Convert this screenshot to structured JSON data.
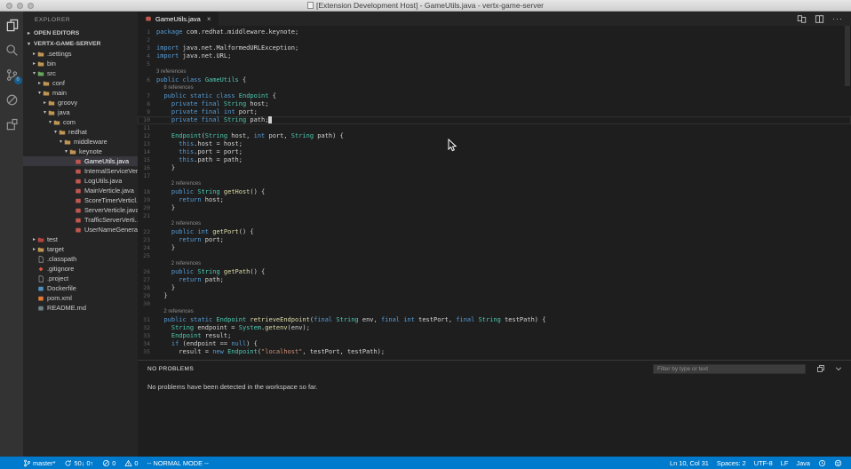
{
  "window": {
    "title": "[Extension Development Host] - GameUtils.java - vertx-game-server"
  },
  "colors": {
    "accent": "#007acc",
    "editor_bg": "#1e1e1e",
    "sidebar_bg": "#252526",
    "activity_bg": "#333333"
  },
  "activity_bar": {
    "items": [
      {
        "name": "explorer",
        "active": true
      },
      {
        "name": "search",
        "active": false
      },
      {
        "name": "source-control",
        "active": false,
        "badge": "6"
      },
      {
        "name": "debug",
        "active": false
      },
      {
        "name": "extensions",
        "active": false
      }
    ]
  },
  "sidebar": {
    "title": "EXPLORER",
    "sections": [
      {
        "label": "OPEN EDITORS",
        "state": "collapsed"
      },
      {
        "label": "VERTX-GAME-SERVER",
        "state": "expanded"
      }
    ],
    "tree": [
      {
        "label": ".settings",
        "level": 1,
        "icon": "folder",
        "arrow": "collapsed"
      },
      {
        "label": "bin",
        "level": 1,
        "icon": "folder",
        "arrow": "collapsed"
      },
      {
        "label": "src",
        "level": 1,
        "icon": "folder-src",
        "arrow": "expanded"
      },
      {
        "label": "conf",
        "level": 2,
        "icon": "folder",
        "arrow": "collapsed"
      },
      {
        "label": "main",
        "level": 2,
        "icon": "folder",
        "arrow": "expanded"
      },
      {
        "label": "groovy",
        "level": 3,
        "icon": "folder",
        "arrow": "collapsed"
      },
      {
        "label": "java",
        "level": 3,
        "icon": "folder",
        "arrow": "expanded"
      },
      {
        "label": "com",
        "level": 4,
        "icon": "folder",
        "arrow": "expanded"
      },
      {
        "label": "redhat",
        "level": 5,
        "icon": "folder",
        "arrow": "expanded"
      },
      {
        "label": "middleware",
        "level": 6,
        "icon": "folder",
        "arrow": "expanded"
      },
      {
        "label": "keynote",
        "level": 7,
        "icon": "folder",
        "arrow": "expanded"
      },
      {
        "label": "GameUtils.java",
        "level": 8,
        "icon": "java",
        "selected": true
      },
      {
        "label": "InternalServiceVer...",
        "level": 8,
        "icon": "java"
      },
      {
        "label": "LogUtils.java",
        "level": 8,
        "icon": "java"
      },
      {
        "label": "MainVerticle.java",
        "level": 8,
        "icon": "java"
      },
      {
        "label": "ScoreTimerVerticl...",
        "level": 8,
        "icon": "java"
      },
      {
        "label": "ServerVerticle.java",
        "level": 8,
        "icon": "java"
      },
      {
        "label": "TrafficServerVerti...",
        "level": 8,
        "icon": "java"
      },
      {
        "label": "UserNameGenerat...",
        "level": 8,
        "icon": "java"
      },
      {
        "label": "test",
        "level": 1,
        "icon": "folder-test",
        "arrow": "collapsed"
      },
      {
        "label": "target",
        "level": 1,
        "icon": "folder",
        "arrow": "collapsed"
      },
      {
        "label": ".classpath",
        "level": 1,
        "icon": "file"
      },
      {
        "label": ".gitignore",
        "level": 1,
        "icon": "git"
      },
      {
        "label": ".project",
        "level": 1,
        "icon": "file"
      },
      {
        "label": "Dockerfile",
        "level": 1,
        "icon": "docker"
      },
      {
        "label": "pom.xml",
        "level": 1,
        "icon": "xml"
      },
      {
        "label": "README.md",
        "level": 1,
        "icon": "md"
      }
    ]
  },
  "editor": {
    "tabs": [
      {
        "label": "GameUtils.java",
        "icon": "java",
        "close": "×",
        "active": true
      }
    ],
    "actions": [
      {
        "name": "open-changes"
      },
      {
        "name": "split-editor"
      },
      {
        "name": "more-actions",
        "glyph": "···"
      }
    ],
    "code": {
      "lines": [
        {
          "n": "1",
          "t": [
            [
              "k",
              "package"
            ],
            [
              "p",
              " com.redhat.middleware.keynote;"
            ]
          ]
        },
        {
          "n": "2",
          "t": []
        },
        {
          "n": "3",
          "t": [
            [
              "k",
              "import"
            ],
            [
              "p",
              " java.net.MalformedURLException;"
            ]
          ]
        },
        {
          "n": "4",
          "t": [
            [
              "k",
              "import"
            ],
            [
              "p",
              " java.net.URL;"
            ]
          ]
        },
        {
          "n": "5",
          "t": []
        },
        {
          "cl": "3 references",
          "ind": 0
        },
        {
          "n": "6",
          "t": [
            [
              "k",
              "public"
            ],
            [
              "p",
              " "
            ],
            [
              "k",
              "class"
            ],
            [
              "p",
              " "
            ],
            [
              "t",
              "GameUtils"
            ],
            [
              "p",
              " {"
            ]
          ]
        },
        {
          "cl": "8 references",
          "ind": 2
        },
        {
          "n": "7",
          "t": [
            [
              "p",
              "  "
            ],
            [
              "k",
              "public"
            ],
            [
              "p",
              " "
            ],
            [
              "k",
              "static"
            ],
            [
              "p",
              " "
            ],
            [
              "k",
              "class"
            ],
            [
              "p",
              " "
            ],
            [
              "t",
              "Endpoint"
            ],
            [
              "p",
              " {"
            ]
          ]
        },
        {
          "n": "8",
          "t": [
            [
              "p",
              "    "
            ],
            [
              "k",
              "private"
            ],
            [
              "p",
              " "
            ],
            [
              "k",
              "final"
            ],
            [
              "p",
              " "
            ],
            [
              "t",
              "String"
            ],
            [
              "p",
              " host;"
            ]
          ]
        },
        {
          "n": "9",
          "t": [
            [
              "p",
              "    "
            ],
            [
              "k",
              "private"
            ],
            [
              "p",
              " "
            ],
            [
              "k",
              "final"
            ],
            [
              "p",
              " "
            ],
            [
              "k",
              "int"
            ],
            [
              "p",
              " port;"
            ]
          ]
        },
        {
          "n": "10",
          "t": [
            [
              "p",
              "    "
            ],
            [
              "k",
              "private"
            ],
            [
              "p",
              " "
            ],
            [
              "k",
              "final"
            ],
            [
              "p",
              " "
            ],
            [
              "t",
              "String"
            ],
            [
              "p",
              " path;"
            ]
          ],
          "cur": true
        },
        {
          "n": "11",
          "t": []
        },
        {
          "n": "12",
          "t": [
            [
              "p",
              "    "
            ],
            [
              "t",
              "Endpoint"
            ],
            [
              "p",
              "("
            ],
            [
              "t",
              "String"
            ],
            [
              "p",
              " host, "
            ],
            [
              "k",
              "int"
            ],
            [
              "p",
              " port, "
            ],
            [
              "t",
              "String"
            ],
            [
              "p",
              " path) {"
            ]
          ]
        },
        {
          "n": "13",
          "t": [
            [
              "p",
              "      "
            ],
            [
              "k",
              "this"
            ],
            [
              "p",
              ".host = host;"
            ]
          ]
        },
        {
          "n": "14",
          "t": [
            [
              "p",
              "      "
            ],
            [
              "k",
              "this"
            ],
            [
              "p",
              ".port = port;"
            ]
          ]
        },
        {
          "n": "15",
          "t": [
            [
              "p",
              "      "
            ],
            [
              "k",
              "this"
            ],
            [
              "p",
              ".path = path;"
            ]
          ]
        },
        {
          "n": "16",
          "t": [
            [
              "p",
              "    }"
            ]
          ]
        },
        {
          "n": "17",
          "t": []
        },
        {
          "cl": "2 references",
          "ind": 4
        },
        {
          "n": "18",
          "t": [
            [
              "p",
              "    "
            ],
            [
              "k",
              "public"
            ],
            [
              "p",
              " "
            ],
            [
              "t",
              "String"
            ],
            [
              "p",
              " "
            ],
            [
              "m",
              "getHost"
            ],
            [
              "p",
              "() {"
            ]
          ]
        },
        {
          "n": "19",
          "t": [
            [
              "p",
              "      "
            ],
            [
              "k",
              "return"
            ],
            [
              "p",
              " host;"
            ]
          ]
        },
        {
          "n": "20",
          "t": [
            [
              "p",
              "    }"
            ]
          ]
        },
        {
          "n": "21",
          "t": []
        },
        {
          "cl": "2 references",
          "ind": 4
        },
        {
          "n": "22",
          "t": [
            [
              "p",
              "    "
            ],
            [
              "k",
              "public"
            ],
            [
              "p",
              " "
            ],
            [
              "k",
              "int"
            ],
            [
              "p",
              " "
            ],
            [
              "m",
              "getPort"
            ],
            [
              "p",
              "() {"
            ]
          ]
        },
        {
          "n": "23",
          "t": [
            [
              "p",
              "      "
            ],
            [
              "k",
              "return"
            ],
            [
              "p",
              " port;"
            ]
          ]
        },
        {
          "n": "24",
          "t": [
            [
              "p",
              "    }"
            ]
          ]
        },
        {
          "n": "25",
          "t": []
        },
        {
          "cl": "2 references",
          "ind": 4
        },
        {
          "n": "26",
          "t": [
            [
              "p",
              "    "
            ],
            [
              "k",
              "public"
            ],
            [
              "p",
              " "
            ],
            [
              "t",
              "String"
            ],
            [
              "p",
              " "
            ],
            [
              "m",
              "getPath"
            ],
            [
              "p",
              "() {"
            ]
          ]
        },
        {
          "n": "27",
          "t": [
            [
              "p",
              "      "
            ],
            [
              "k",
              "return"
            ],
            [
              "p",
              " path;"
            ]
          ]
        },
        {
          "n": "28",
          "t": [
            [
              "p",
              "    }"
            ]
          ]
        },
        {
          "n": "29",
          "t": [
            [
              "p",
              "  }"
            ]
          ]
        },
        {
          "n": "30",
          "t": []
        },
        {
          "cl": "2 references",
          "ind": 2
        },
        {
          "n": "31",
          "t": [
            [
              "p",
              "  "
            ],
            [
              "k",
              "public"
            ],
            [
              "p",
              " "
            ],
            [
              "k",
              "static"
            ],
            [
              "p",
              " "
            ],
            [
              "t",
              "Endpoint"
            ],
            [
              "p",
              " "
            ],
            [
              "m",
              "retrieveEndpoint"
            ],
            [
              "p",
              "("
            ],
            [
              "k",
              "final"
            ],
            [
              "p",
              " "
            ],
            [
              "t",
              "String"
            ],
            [
              "p",
              " env, "
            ],
            [
              "k",
              "final"
            ],
            [
              "p",
              " "
            ],
            [
              "k",
              "int"
            ],
            [
              "p",
              " testPort, "
            ],
            [
              "k",
              "final"
            ],
            [
              "p",
              " "
            ],
            [
              "t",
              "String"
            ],
            [
              "p",
              " testPath) {"
            ]
          ]
        },
        {
          "n": "32",
          "t": [
            [
              "p",
              "    "
            ],
            [
              "t",
              "String"
            ],
            [
              "p",
              " endpoint = "
            ],
            [
              "t",
              "System"
            ],
            [
              "p",
              "."
            ],
            [
              "m",
              "getenv"
            ],
            [
              "p",
              "(env);"
            ]
          ]
        },
        {
          "n": "33",
          "t": [
            [
              "p",
              "    "
            ],
            [
              "t",
              "Endpoint"
            ],
            [
              "p",
              " result;"
            ]
          ]
        },
        {
          "n": "34",
          "t": [
            [
              "p",
              "    "
            ],
            [
              "k",
              "if"
            ],
            [
              "p",
              " (endpoint == "
            ],
            [
              "k",
              "null"
            ],
            [
              "p",
              ") {"
            ]
          ]
        },
        {
          "n": "35",
          "t": [
            [
              "p",
              "      result = "
            ],
            [
              "k",
              "new"
            ],
            [
              "p",
              " "
            ],
            [
              "t",
              "Endpoint"
            ],
            [
              "p",
              "("
            ],
            [
              "s",
              "\"localhost\""
            ],
            [
              "p",
              ", testPort, testPath);"
            ]
          ]
        }
      ]
    }
  },
  "panel": {
    "header": "NO PROBLEMS",
    "filter_placeholder": "Filter by type or text",
    "message": "No problems have been detected in the workspace so far.",
    "icons": [
      {
        "name": "clear-filter"
      },
      {
        "name": "chevron-down"
      }
    ]
  },
  "status_bar": {
    "left": [
      {
        "icon": "branch",
        "label": "master*"
      },
      {
        "icon": "sync",
        "label": "50↓ 0↑"
      },
      {
        "icon": "error",
        "label": "0"
      },
      {
        "icon": "warning",
        "label": "0"
      },
      {
        "label": "-- NORMAL MODE --"
      }
    ],
    "right": [
      {
        "label": "Ln 10, Col 31"
      },
      {
        "label": "Spaces: 2"
      },
      {
        "label": "UTF-8"
      },
      {
        "label": "LF"
      },
      {
        "label": "Java"
      },
      {
        "icon": "clock"
      },
      {
        "icon": "smiley"
      }
    ]
  }
}
